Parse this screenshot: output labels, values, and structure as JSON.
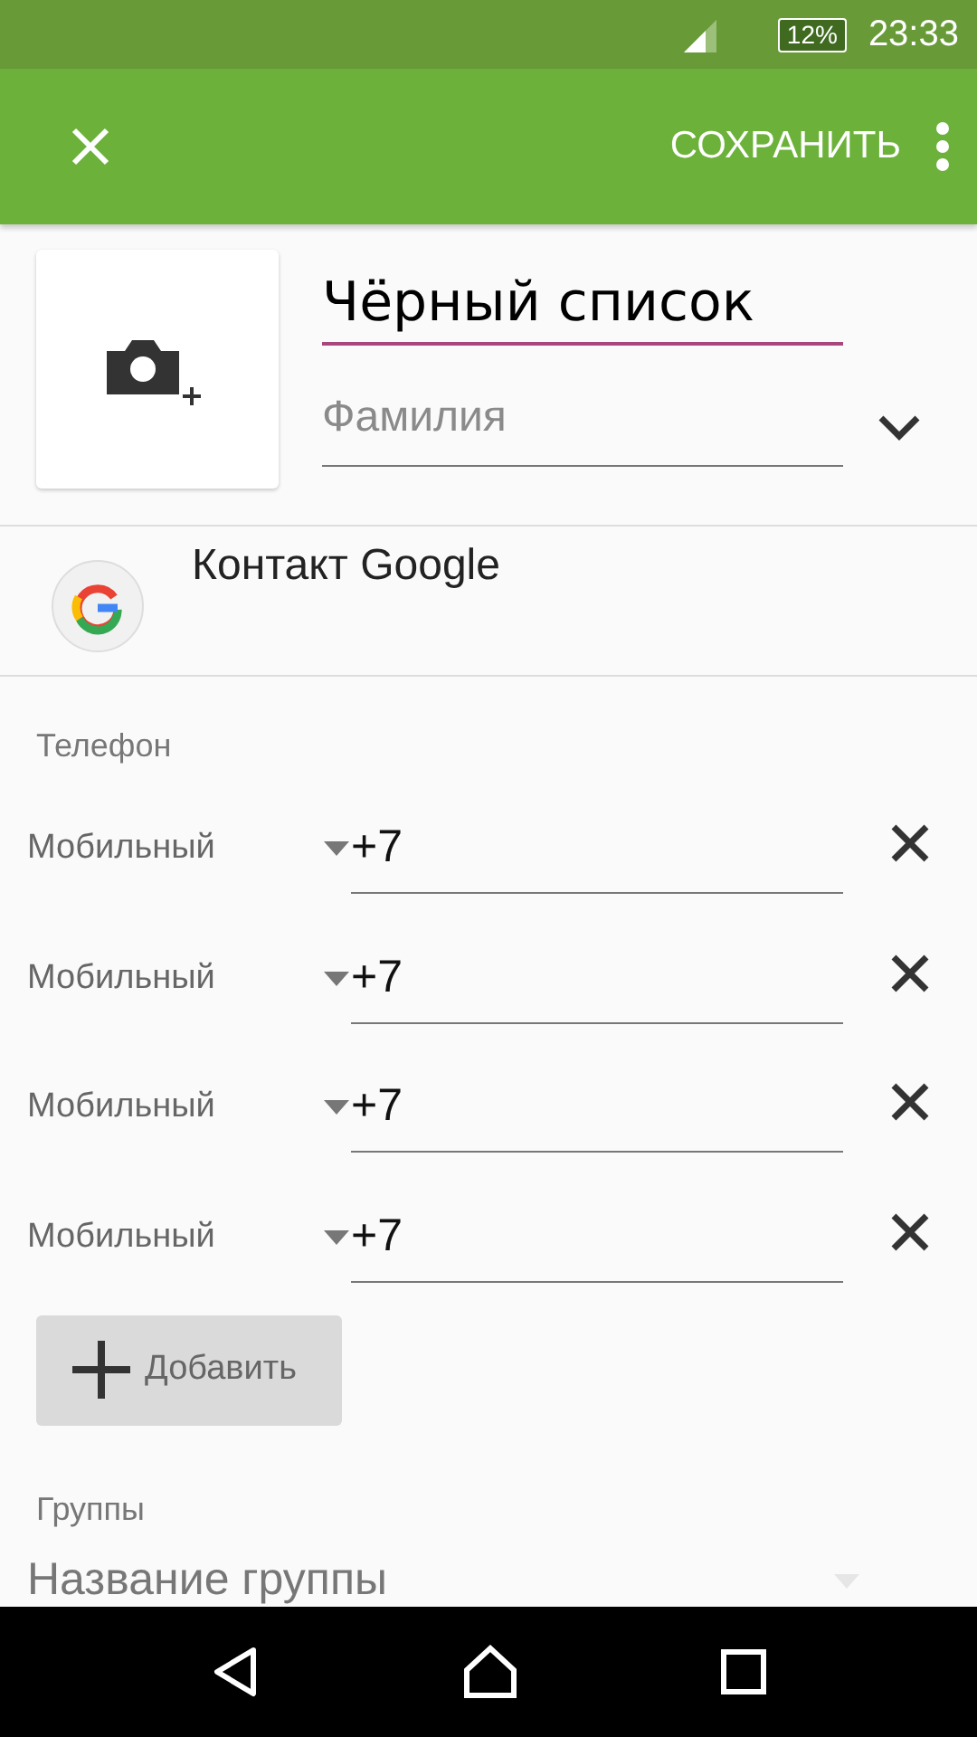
{
  "status_bar": {
    "battery": "12%",
    "time": "23:33"
  },
  "toolbar": {
    "save": "СОХРАНИТЬ"
  },
  "name_field": {
    "value": "Чёрный список",
    "focused": true
  },
  "surname_field": {
    "placeholder": "Фамилия"
  },
  "account": {
    "label": "Контакт Google"
  },
  "phone": {
    "title": "Телефон",
    "rows": [
      {
        "type": "Мобильный",
        "value": "+7"
      },
      {
        "type": "Мобильный",
        "value": "+7"
      },
      {
        "type": "Мобильный",
        "value": "+7"
      },
      {
        "type": "Мобильный",
        "value": "+7"
      }
    ],
    "add": "Добавить"
  },
  "groups": {
    "title": "Группы",
    "placeholder": "Название группы"
  }
}
